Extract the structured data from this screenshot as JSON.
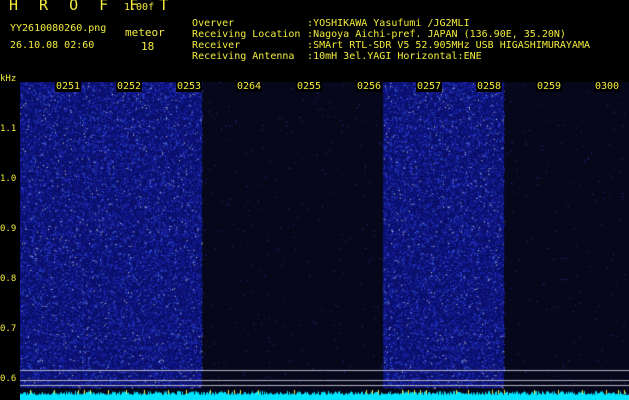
{
  "app": {
    "title": "H R O F F T",
    "version": "1.00f",
    "filename": "YY2610080260.png",
    "datetime": "26.10.08 02:60"
  },
  "meteor": {
    "label": "meteor",
    "count": "18"
  },
  "station": [
    {
      "key": "Overver",
      "value": ":YOSHIKAWA Yasufumi /JG2MLI"
    },
    {
      "key": "Receiving Location",
      "value": ":Nagoya Aichi-pref. JAPAN (136.90E, 35.20N)"
    },
    {
      "key": "Receiver",
      "value": ":SMArt RTL-SDR V5 52.905MHz USB HIGASHIMURAYAMA"
    },
    {
      "key": "Receiving Antenna",
      "value": ":10mH 3el.YAGI Horizontal:ENE"
    }
  ],
  "spectrogram": {
    "y_unit": "kHz",
    "y_ticks": [
      "1.1",
      "1.0",
      "0.9",
      "0.8",
      "0.7",
      "0.6"
    ],
    "minute_labels": [
      "0251",
      "0252",
      "0253",
      "0264",
      "0255",
      "0256",
      "0257",
      "0258",
      "0259",
      "0300"
    ],
    "active_minutes": [
      true,
      true,
      true,
      false,
      false,
      false,
      true,
      true,
      false,
      false
    ],
    "colors": {
      "noise": "#1a2ec8",
      "silent": "#06071a",
      "baseline": "#00e5ff",
      "text": "#f2ec3c"
    }
  }
}
